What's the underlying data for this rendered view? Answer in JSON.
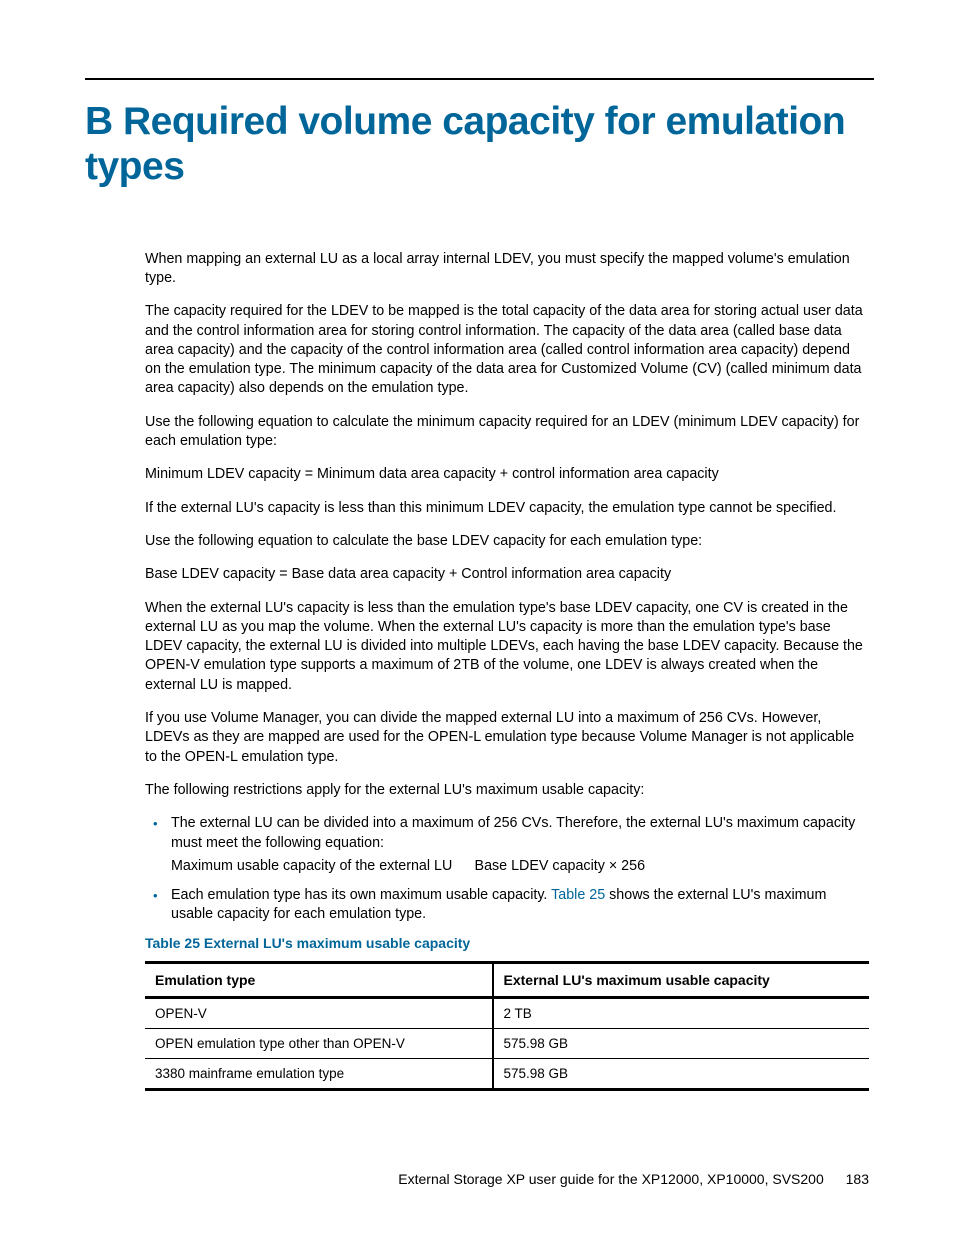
{
  "title": "B Required volume capacity for emulation types",
  "paragraphs": {
    "p1": "When mapping an external LU as a local array internal LDEV, you must specify the mapped volume's emulation type.",
    "p2": "The capacity required for the LDEV to be mapped is the total capacity of the data area for storing actual user data and the control information area for storing control information. The capacity of the data area (called base data area capacity) and the capacity of the control information area (called control information area capacity) depend on the emulation type. The minimum capacity of the data area for Customized Volume (CV) (called minimum data area capacity) also depends on the emulation type.",
    "p3": "Use the following equation to calculate the minimum capacity required for an LDEV (minimum LDEV capacity) for each emulation type:",
    "p4": "Minimum LDEV capacity = Minimum data area capacity + control information area capacity",
    "p5": "If the external LU's capacity is less than this minimum LDEV capacity, the emulation type cannot be specified.",
    "p6": "Use the following equation to calculate the base LDEV capacity for each emulation type:",
    "p7": "Base LDEV capacity = Base data area capacity + Control information area capacity",
    "p8": "When the external LU's capacity is less than the emulation type's base LDEV capacity, one CV is created in the external LU as you map the volume. When the external LU's capacity is more than the emulation type's base LDEV capacity, the external LU is divided into multiple LDEVs, each having the base LDEV capacity. Because the OPEN-V emulation type supports a maximum of 2TB of the volume, one LDEV is always created when the external LU is mapped.",
    "p9": "If you use Volume Manager, you can divide the mapped external LU into a maximum of 256 CVs. However, LDEVs as they are mapped are used for the OPEN-L emulation type because Volume Manager is not applicable to the OPEN-L emulation type.",
    "p10": "The following restrictions apply for the external LU's maximum usable capacity:"
  },
  "bullets": {
    "b1a": "The external LU can be divided into a maximum of 256 CVs. Therefore, the external LU's maximum capacity must meet the following equation:",
    "b1b": "Maximum usable capacity of the external LU   Base LDEV capacity × 256",
    "b2a": "Each emulation type has its own maximum usable capacity. ",
    "b2link": "Table 25",
    "b2b": " shows the external LU's maximum usable capacity for each emulation type."
  },
  "table": {
    "caption": "Table 25 External LU's maximum usable capacity",
    "headers": [
      "Emulation type",
      "External LU's maximum usable capacity"
    ],
    "rows": [
      [
        "OPEN-V",
        "2 TB"
      ],
      [
        "OPEN emulation type other than OPEN-V",
        "575.98 GB"
      ],
      [
        "3380 mainframe emulation type",
        "575.98 GB"
      ]
    ]
  },
  "footer": {
    "text": "External Storage XP user guide for the XP12000, XP10000, SVS200",
    "page": "183"
  }
}
